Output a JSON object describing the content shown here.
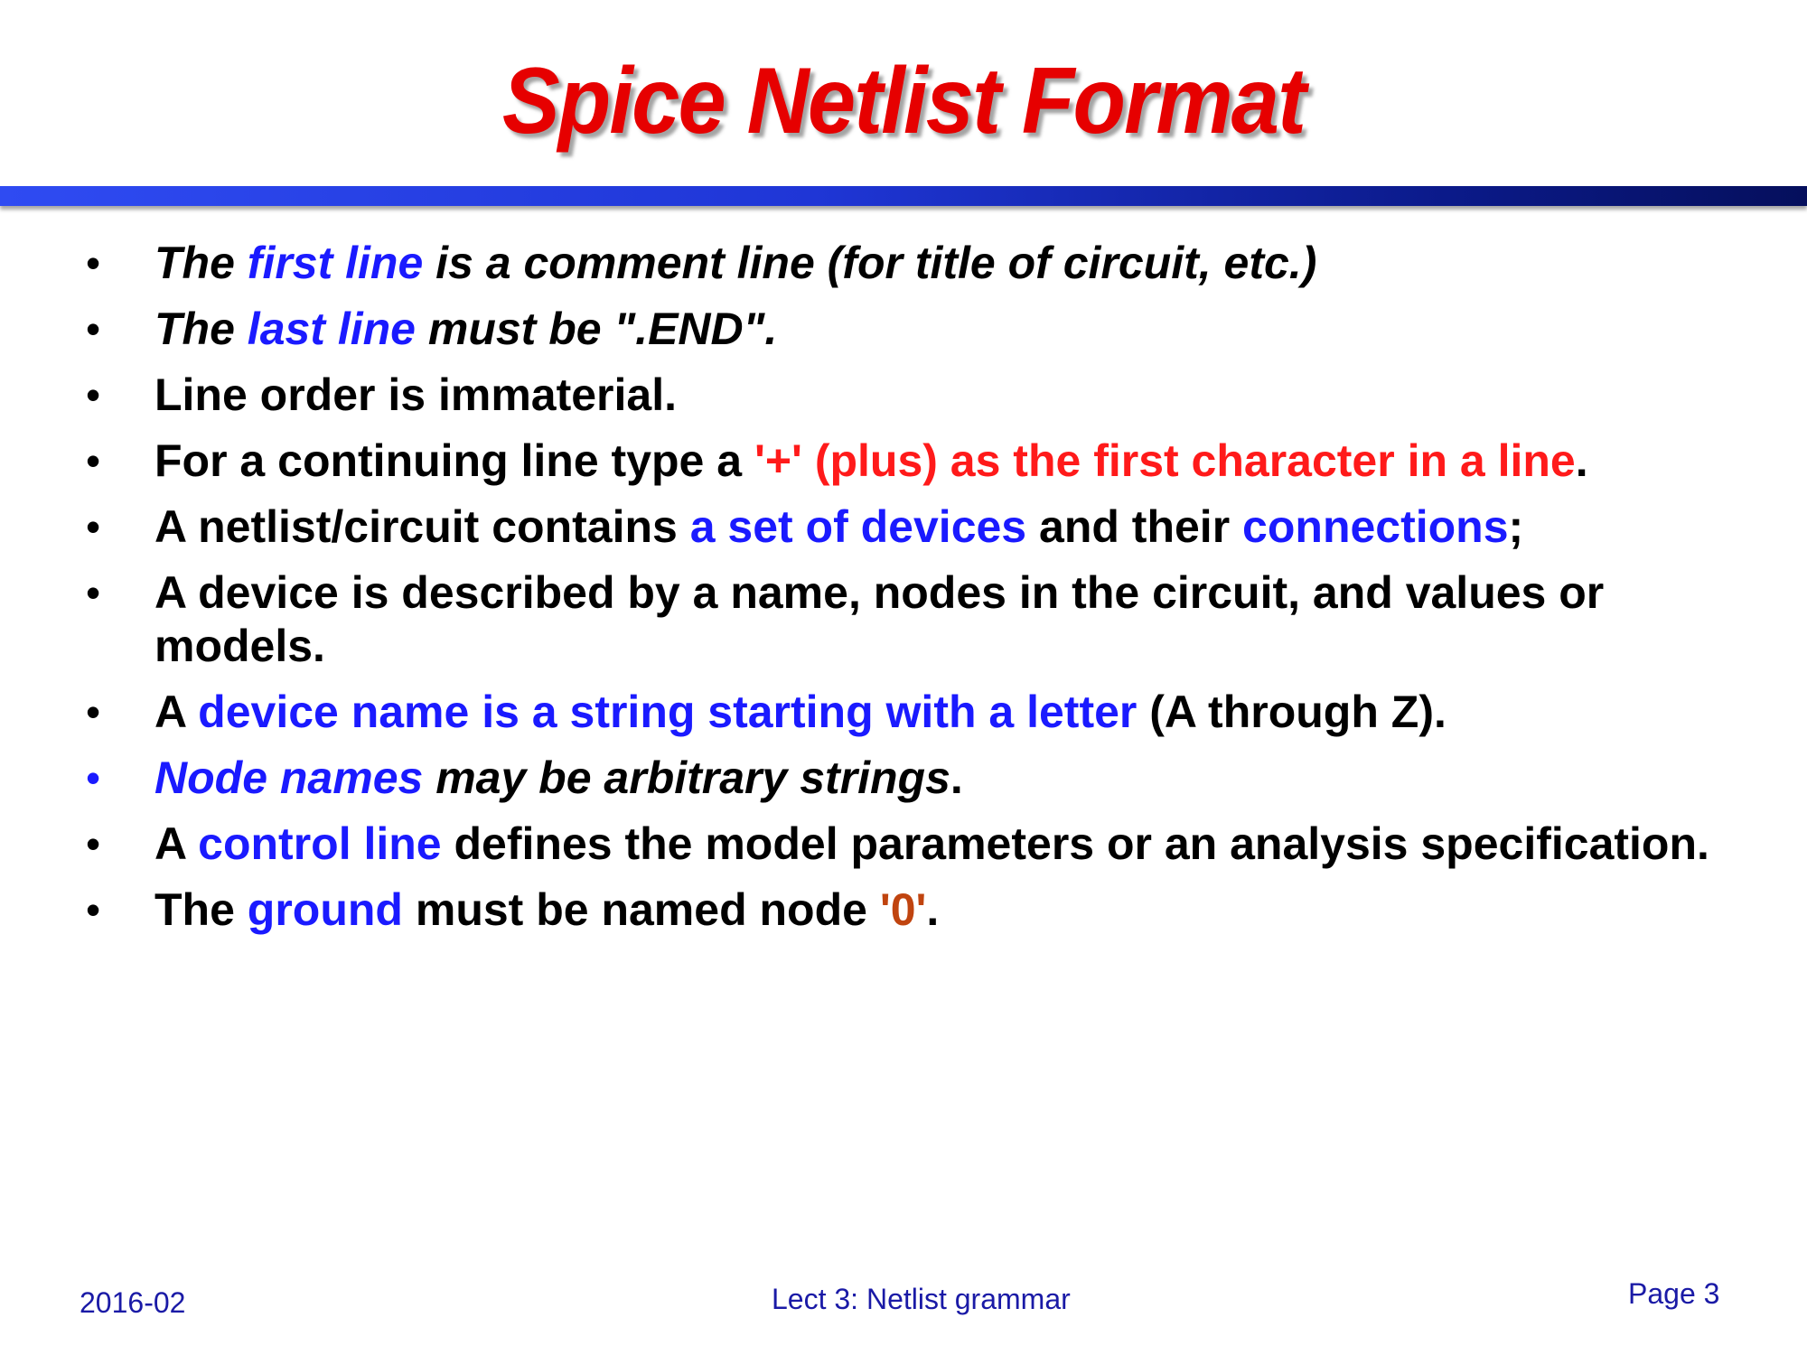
{
  "title": "Spice Netlist Format",
  "bullet_symbol": "•",
  "bullets": [
    {
      "parts": [
        {
          "text": "The ",
          "color": "black",
          "italic": true
        },
        {
          "text": "first line",
          "color": "blue",
          "italic": true
        },
        {
          "text": " is a comment line (for title of circuit, etc.)",
          "color": "black",
          "italic": true
        }
      ]
    },
    {
      "parts": [
        {
          "text": "The ",
          "color": "black",
          "italic": true
        },
        {
          "text": "last line",
          "color": "blue",
          "italic": true
        },
        {
          "text": " must be \".END\".",
          "color": "black",
          "italic": true
        }
      ]
    },
    {
      "parts": [
        {
          "text": "Line order is immaterial.",
          "color": "black"
        }
      ]
    },
    {
      "parts": [
        {
          "text": "For a continuing line type a ",
          "color": "black"
        },
        {
          "text": "'+' (plus) as the first character in a line",
          "color": "red"
        },
        {
          "text": ".",
          "color": "black"
        }
      ]
    },
    {
      "parts": [
        {
          "text": "A netlist/circuit contains ",
          "color": "black"
        },
        {
          "text": "a set of devices",
          "color": "blue"
        },
        {
          "text": " and their ",
          "color": "black"
        },
        {
          "text": "connections",
          "color": "blue"
        },
        {
          "text": ";",
          "color": "black"
        }
      ]
    },
    {
      "parts": [
        {
          "text": "A device is described by a name, nodes in the circuit, and values or models.",
          "color": "black"
        }
      ]
    },
    {
      "parts": [
        {
          "text": "A ",
          "color": "black"
        },
        {
          "text": "device name is a string starting with a letter",
          "color": "blue"
        },
        {
          "text": " (A through Z).",
          "color": "black"
        }
      ]
    },
    {
      "bullet_color": "blue",
      "parts": [
        {
          "text": "Node names",
          "color": "blue",
          "italic": true
        },
        {
          "text": " may be arbitrary strings",
          "color": "black",
          "italic": true
        },
        {
          "text": ".",
          "color": "black"
        }
      ]
    },
    {
      "parts": [
        {
          "text": "A ",
          "color": "black"
        },
        {
          "text": "control line",
          "color": "blue"
        },
        {
          "text": " defines the model parameters or an analysis specification.",
          "color": "black"
        }
      ]
    },
    {
      "parts": [
        {
          "text": "The ",
          "color": "black"
        },
        {
          "text": "ground",
          "color": "blue"
        },
        {
          "text": " must be named node ",
          "color": "black"
        },
        {
          "text": "'0'",
          "color": "orange"
        },
        {
          "text": ".",
          "color": "black"
        }
      ]
    }
  ],
  "footer": {
    "date": "2016-02",
    "lecture": "Lect 3: Netlist grammar",
    "page": "Page 3"
  },
  "colors": {
    "title": "#e60000",
    "blue_text": "#1a1aff",
    "red_text": "#ff1a1a",
    "orange_text": "#c0440f",
    "rule_start": "#2f4bf2",
    "rule_end": "#050f5c",
    "footer_text": "#1a1aa6"
  }
}
